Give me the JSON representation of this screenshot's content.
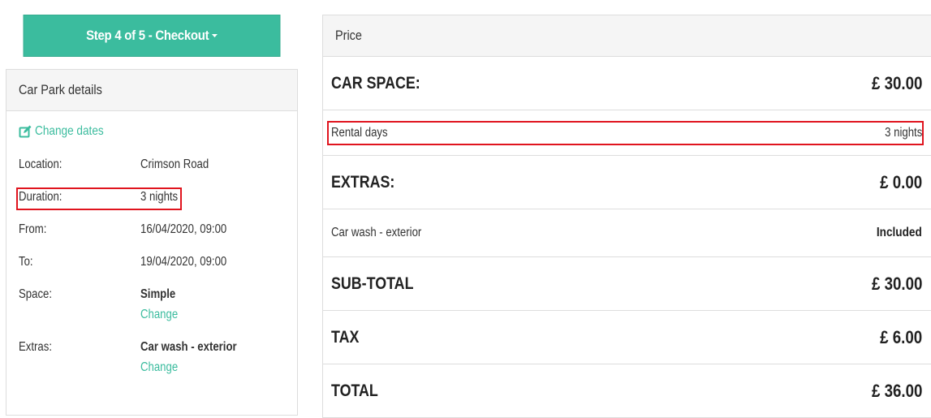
{
  "checkout": {
    "step_label": "Step 4 of 5 - Checkout"
  },
  "carpark": {
    "heading": "Car Park details",
    "change_dates_label": "Change dates",
    "rows": {
      "location": {
        "label": "Location:",
        "value": "Crimson Road"
      },
      "duration": {
        "label": "Duration:",
        "value": "3 nights"
      },
      "from": {
        "label": "From:",
        "value": "16/04/2020, 09:00"
      },
      "to": {
        "label": "To:",
        "value": "19/04/2020, 09:00"
      },
      "space": {
        "label": "Space:",
        "value": "Simple",
        "change_label": "Change"
      },
      "extras": {
        "label": "Extras:",
        "value": "Car wash - exterior",
        "change_label": "Change"
      }
    }
  },
  "price": {
    "heading": "Price",
    "car_space": {
      "label": "CAR SPACE:",
      "value": "£ 30.00"
    },
    "rental_days": {
      "label": "Rental days",
      "value": "3 nights"
    },
    "extras": {
      "label": "EXTRAS:",
      "value": "£ 0.00"
    },
    "car_wash": {
      "label": "Car wash - exterior",
      "value": "Included"
    },
    "subtotal": {
      "label": "SUB-TOTAL",
      "value": "£ 30.00"
    },
    "tax": {
      "label": "TAX",
      "value": "£ 6.00"
    },
    "total": {
      "label": "TOTAL",
      "value": "£ 36.00"
    }
  },
  "colors": {
    "accent": "#3bbc9e",
    "highlight": "#e0141e",
    "border": "#dddddd",
    "heading_bg": "#f5f5f5"
  },
  "icons": {
    "change_dates": "edit-icon",
    "step_dropdown": "caret-down-icon"
  }
}
